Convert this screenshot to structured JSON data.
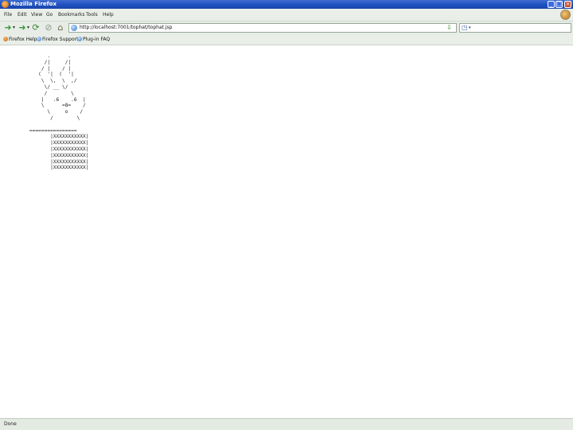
{
  "window": {
    "title": "Mozilla Firefox"
  },
  "menus": [
    "File",
    "Edit",
    "View",
    "Go",
    "Bookmarks",
    "Tools",
    "Help"
  ],
  "url": "http://localhost:7001/tophat/tophat.jsp",
  "bookmarks": [
    "Firefox Help",
    "Firefox Support",
    "Plug-in FAQ"
  ],
  "ascii_art": "      .      .\n     /|     /|\n    / |    / |\n   (  '|  (  '|\n    \\  \\,  \\  ,/\n     \\/ __ \\/\n     /        \\\n    |   .6    .6  |\n    \\      =8=    /\n      \\     o    /\n       /        \\\n\n================\n       |XXXXXXXXXXX|\n       |XXXXXXXXXXX|\n       |XXXXXXXXXXX|\n       |XXXXXXXXXXX|\n       |XXXXXXXXXXX|\n       |XXXXXXXXXXX|",
  "status": "Done",
  "colors": {
    "titlebar": "#1d4fbf",
    "chrome": "#e9efe8"
  },
  "icons": {
    "back": "back-arrow-icon",
    "forward": "forward-arrow-icon",
    "reload": "reload-icon",
    "stop": "stop-icon",
    "home": "home-icon",
    "go": "go-arrow-icon",
    "search": "search-engine-icon"
  }
}
